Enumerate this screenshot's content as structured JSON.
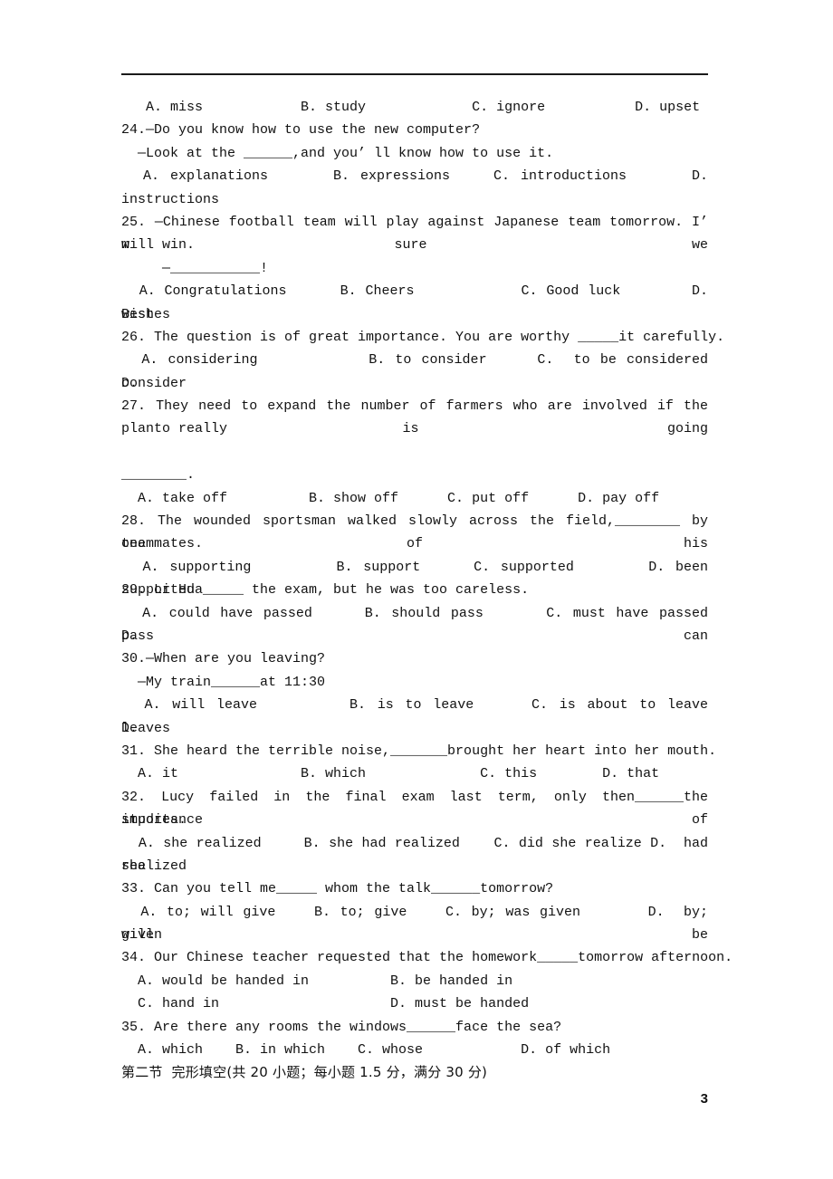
{
  "document": {
    "page_number": "3",
    "text_color": "#111111",
    "background_color": "#ffffff",
    "rule_color": "#1a1a1a"
  },
  "lines": {
    "q23_options": "   A. miss            B. study             C. ignore           D. upset",
    "q24_stem": "24.—Do you know how to use the new computer?",
    "q24_stem2": "  —Look at the ______,and you’ ll know how to use it.",
    "q24_options": "  A. explanations      B. expressions    C. introductions      D.",
    "q24_options_wrap": "instructions",
    "q25_stem": "25. —Chinese football team will play against Japanese team tomorrow. I’ m sure we",
    "q25_stem2": "will win.",
    "q25_stem3": "     —___________!",
    "q25_options": "  A. Congratulations      B. Cheers            C. Good luck        D.    Best",
    "q25_options_wrap": "wishes",
    "q26_stem": "26. The question is of great importance. You are worthy _____it carefully.",
    "q26_options": "  A. considering           B. to consider     C.  to be considered      D.",
    "q26_options_wrap": "consider",
    "q27_stem": "27. They need to expand the number of farmers who are involved if the plan is going",
    "q27_stem2": "    to really",
    "q27_stem3": "________.",
    "q27_options": "  A. take off          B. show off      C. put off      D. pay off",
    "q28_stem": "28. The wounded sportsman walked slowly across the field,________ by one of his",
    "q28_stem2": "teammates.",
    "q28_options": "  A. supporting        B. support     C. supported       D. been supported",
    "q29_stem": "29. Li Hua_____ the exam, but he was too careless.",
    "q29_options": "  A. could have passed     B. should pass      C. must have passed    D.   can",
    "q29_options_wrap": "pass",
    "q30_stem": "30.—When are you leaving?",
    "q30_stem2": "  —My train______at 11:30",
    "q30_options": "  A. will leave        B. is to leave     C. is about to leave        D.",
    "q30_options_wrap": "leaves",
    "q31_stem": "31. She heard the terrible noise,_______brought her heart into her mouth.",
    "q31_options": "  A. it               B. which              C. this        D. that",
    "q32_stem": "32. Lucy failed in the final exam last term, only then______the importance of",
    "q32_stem2": "studies.",
    "q32_options": "  A. she realized     B. she had realized    C. did she realize D.  had she",
    "q32_options_wrap": "realized",
    "q33_stem": "33. Can you tell me_____ whom the talk______tomorrow?",
    "q33_options": "  A. to; will give    B. to; give    C. by; was given       D.  by; will be",
    "q33_options_wrap": "given",
    "q34_stem": "34. Our Chinese teacher requested that the homework_____tomorrow afternoon.",
    "q34_option_ab": "  A. would be handed in          B. be handed in",
    "q34_option_cd": "  C. hand in                     D. must be handed",
    "q35_stem": "35. Are there any rooms the windows______face the sea?",
    "q35_options": "  A. which    B. in which    C. whose            D. of which",
    "section_heading": "第二节  完形填空(共 20 小题；每小题 1.5 分，满分 30 分)"
  }
}
